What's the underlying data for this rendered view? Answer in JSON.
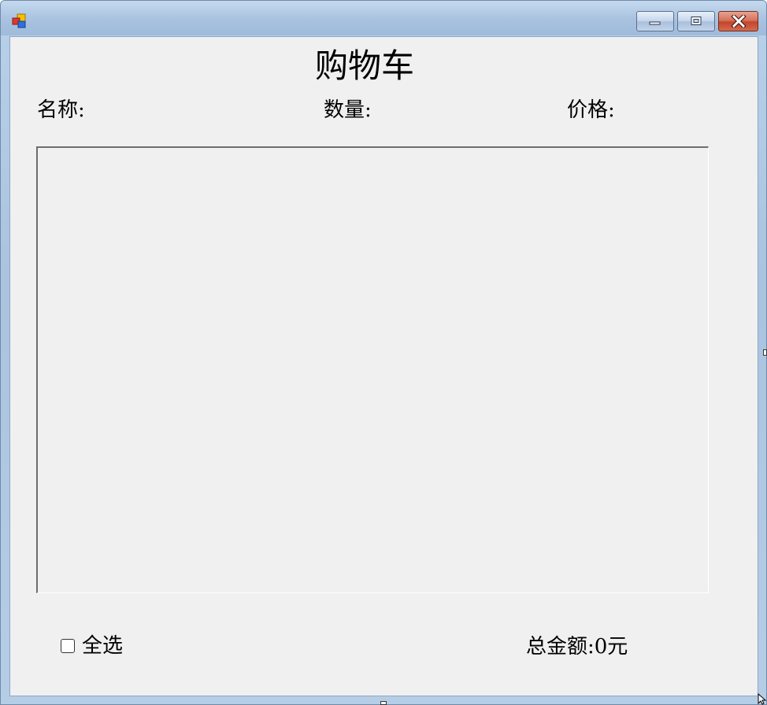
{
  "window": {
    "icon": "app-window-icon",
    "controls": {
      "minimize_icon": "minimize-icon",
      "maximize_icon": "maximize-icon",
      "close_icon": "close-icon"
    },
    "colors": {
      "client_bg": "#f0f0f0",
      "close_button": "#c2462c",
      "titlebar": "#a8c2df"
    }
  },
  "form": {
    "title": "购物车",
    "columns": {
      "name_label": "名称:",
      "quantity_label": "数量:",
      "price_label": "价格:"
    },
    "items": [],
    "select_all_label": "全选",
    "select_all_checked": false,
    "total_label": "总金额:0元"
  }
}
